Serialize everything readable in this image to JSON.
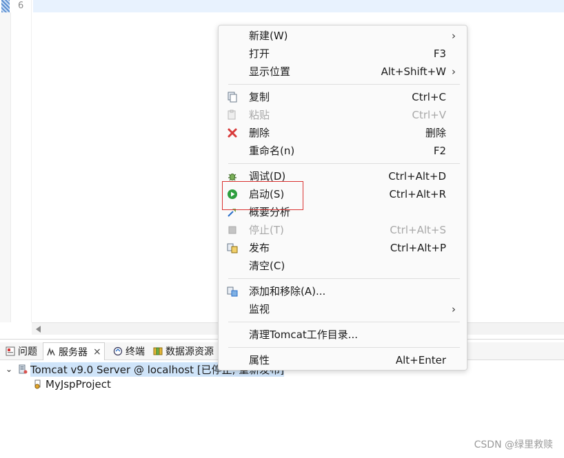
{
  "editor": {
    "line_number": "6"
  },
  "panel": {
    "tabs": [
      {
        "label": "问题",
        "icon": "problems-icon"
      },
      {
        "label": "服务器",
        "icon": "servers-icon",
        "close": "×"
      },
      {
        "label": "终端",
        "icon": "terminal-icon"
      },
      {
        "label": "数据源资源",
        "icon": "datasource-icon"
      }
    ],
    "tree": {
      "server": {
        "caret": "⌄",
        "label": "Tomcat v9.0 Server @ localhost  [已停止, 重新发布]"
      },
      "project": {
        "label": "MyJspProject"
      }
    }
  },
  "context_menu": {
    "items": [
      {
        "label": "新建(W)",
        "shortcut": "",
        "submenu": "›"
      },
      {
        "label": "打开",
        "shortcut": "F3"
      },
      {
        "label": "显示位置",
        "shortcut": "Alt+Shift+W",
        "submenu": "›"
      },
      {
        "label": "复制",
        "shortcut": "Ctrl+C",
        "icon": "copy-icon"
      },
      {
        "label": "粘贴",
        "shortcut": "Ctrl+V",
        "icon": "paste-icon",
        "disabled": true
      },
      {
        "label": "删除",
        "shortcut": "删除",
        "icon": "delete-icon"
      },
      {
        "label": "重命名(n)",
        "shortcut": "F2"
      },
      {
        "label": "调试(D)",
        "shortcut": "Ctrl+Alt+D",
        "icon": "debug-icon"
      },
      {
        "label": "启动(S)",
        "shortcut": "Ctrl+Alt+R",
        "icon": "start-icon"
      },
      {
        "label": "概要分析",
        "shortcut": "",
        "icon": "profile-icon"
      },
      {
        "label": "停止(T)",
        "shortcut": "Ctrl+Alt+S",
        "icon": "stop-icon",
        "disabled": true
      },
      {
        "label": "发布",
        "shortcut": "Ctrl+Alt+P",
        "icon": "publish-icon"
      },
      {
        "label": "清空(C)",
        "shortcut": ""
      },
      {
        "label": "添加和移除(A)...",
        "shortcut": "",
        "icon": "add-remove-icon"
      },
      {
        "label": "监视",
        "shortcut": "",
        "submenu": "›"
      },
      {
        "label": "清理Tomcat工作目录...",
        "shortcut": ""
      },
      {
        "label": "属性",
        "shortcut": "Alt+Enter"
      }
    ]
  },
  "colors": {
    "accent_highlight": "#d9312f",
    "selection": "#cfe4f9",
    "start_green": "#2e9e3e"
  },
  "watermark": "CSDN @绿里救赎"
}
